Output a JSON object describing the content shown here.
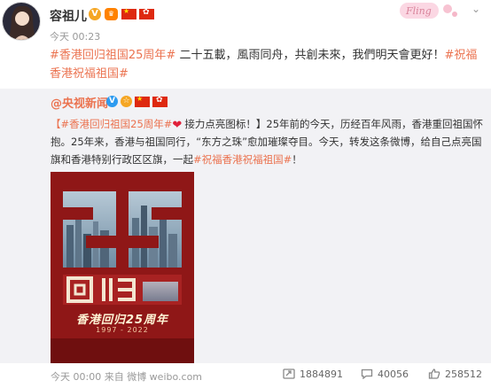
{
  "post": {
    "author": "容祖儿",
    "badge_v": "V",
    "time": "今天 00:23",
    "text_prefix": "#香港回归祖国25周年#",
    "text_body": " 二十五載，風雨同舟，共創未來，我們明天會更好！",
    "text_suffix": "#祝福香港祝福祖国#",
    "deco_text": "Fling"
  },
  "repost": {
    "author": "@央视新闻",
    "badge_v": "V",
    "text_tag": "【#香港回归祖国25周年#",
    "text_heart_after": "接力点亮图标！】",
    "text_body": "25年前的今天，历经百年风雨，香港重回祖国怀抱。25年来，香港与祖国同行，“东方之珠”愈加璀璨夺目。今天，转发这条微博，给自己点亮国旗和香港特别行政区区旗，一起",
    "text_tag2": "#祝福香港祝福祖国#",
    "text_end": "！",
    "poster": {
      "big_number": "25",
      "return_char": "回归",
      "slogan": "香港回归25周年",
      "years": "1997 - 2022"
    }
  },
  "footer": {
    "time_source": "今天 00:00 来自 微博 weibo.com",
    "reposts": "1884891",
    "comments": "40056",
    "likes": "258512"
  },
  "colors": {
    "link": "#eb7350",
    "repost_bg": "#f2f2f5",
    "poster_red": "#8f1717"
  }
}
